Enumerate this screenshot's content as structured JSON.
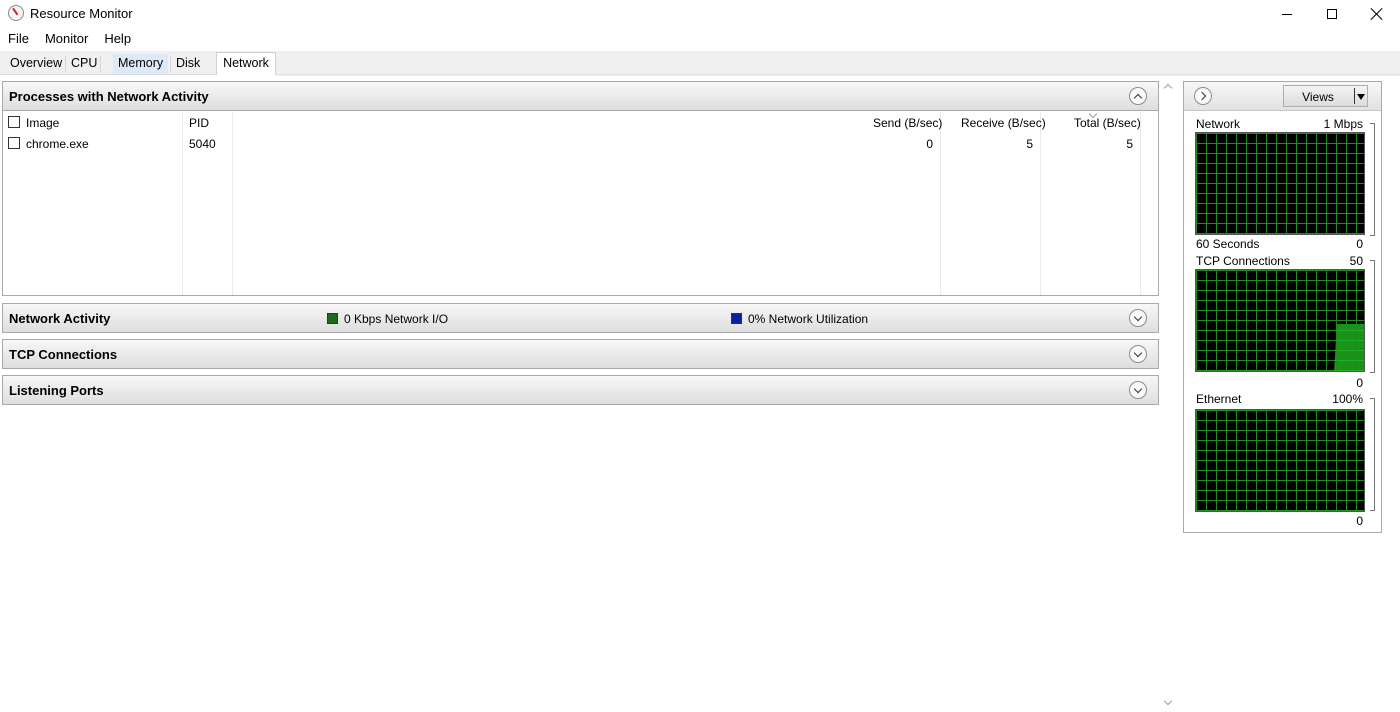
{
  "window": {
    "title": "Resource Monitor"
  },
  "menu": [
    "File",
    "Monitor",
    "Help"
  ],
  "tabs": [
    {
      "label": "Overview"
    },
    {
      "label": "CPU"
    },
    {
      "label": "Memory"
    },
    {
      "label": "Disk"
    },
    {
      "label": "Network"
    }
  ],
  "sections": {
    "processes": {
      "title": "Processes with Network Activity",
      "columns": [
        "Image",
        "PID",
        "Send (B/sec)",
        "Receive (B/sec)",
        "Total (B/sec)"
      ],
      "rows": [
        {
          "image": "chrome.exe",
          "pid": "5040",
          "send": "0",
          "receive": "5",
          "total": "5",
          "checked": false
        }
      ]
    },
    "network_activity": {
      "title": "Network Activity",
      "legend": [
        {
          "text": "0 Kbps Network I/O",
          "color": "#1e6b1e"
        },
        {
          "text": "0% Network Utilization",
          "color": "#0a1ea0"
        }
      ]
    },
    "tcp": {
      "title": "TCP Connections"
    },
    "listening": {
      "title": "Listening Ports"
    }
  },
  "sidebar": {
    "views_label": "Views",
    "graphs": [
      {
        "name": "Network",
        "max": "1 Mbps",
        "foot_left": "60 Seconds",
        "foot_right": "0",
        "fill_fraction": 0.0
      },
      {
        "name": "TCP Connections",
        "max": "50",
        "foot_left": "",
        "foot_right": "0",
        "fill_fraction": 0.47
      },
      {
        "name": "Ethernet",
        "max": "100%",
        "foot_left": "",
        "foot_right": "0",
        "fill_fraction": 0.0
      }
    ]
  },
  "colors": {
    "graph_grid": "#1e8c1e",
    "graph_fill": "#22c322",
    "graph_bg": "#000000"
  }
}
